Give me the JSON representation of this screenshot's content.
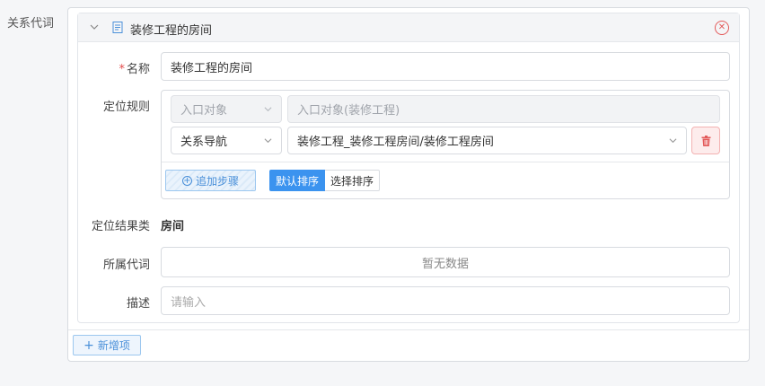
{
  "outer": {
    "label": "关系代词"
  },
  "card": {
    "title": "装修工程的房间"
  },
  "form": {
    "name": {
      "label": "名称",
      "value": "装修工程的房间"
    },
    "rule": {
      "label": "定位规则",
      "rows": [
        {
          "type": "入口对象",
          "target": "入口对象(装修工程)",
          "disabled": true
        },
        {
          "type": "关系导航",
          "target": "装修工程_装修工程房间/装修工程房间",
          "disabled": false
        }
      ],
      "add_step": "追加步骤",
      "sort": {
        "default": "默认排序",
        "choose": "选择排序"
      }
    },
    "result": {
      "label": "定位结果类",
      "value": "房间"
    },
    "owner": {
      "label": "所属代词",
      "empty": "暂无数据"
    },
    "desc": {
      "label": "描述",
      "placeholder": "请输入"
    }
  },
  "footer": {
    "add_item": "新增项"
  },
  "colors": {
    "accent": "#3b93ef",
    "danger": "#e35a5a"
  }
}
